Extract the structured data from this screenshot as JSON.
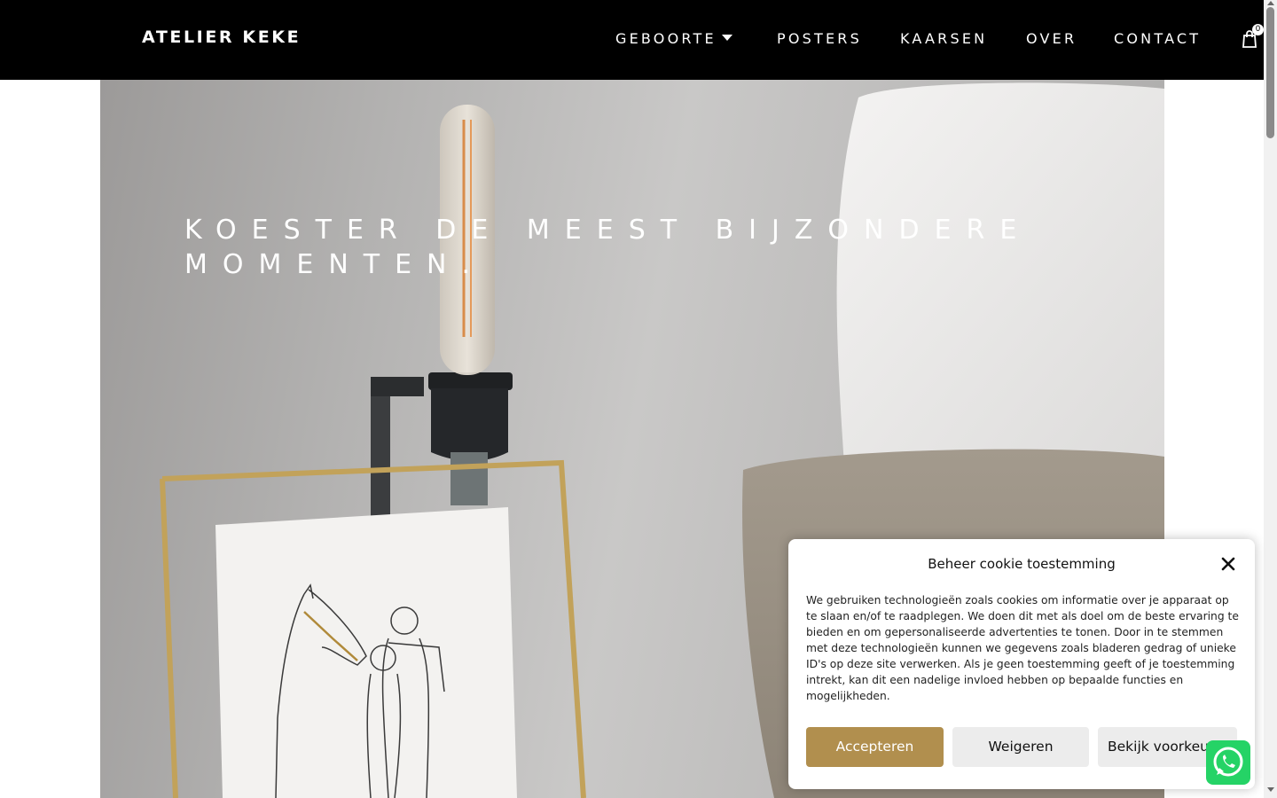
{
  "header": {
    "logo": "ATELIER KEKE",
    "nav": [
      {
        "label": "GEBOORTE",
        "has_dropdown": true
      },
      {
        "label": "POSTERS",
        "has_dropdown": false
      },
      {
        "label": "KAARSEN",
        "has_dropdown": false
      },
      {
        "label": "OVER",
        "has_dropdown": false
      },
      {
        "label": "CONTACT",
        "has_dropdown": false
      }
    ],
    "cart_icon": "shopping-bag-icon",
    "cart_count": "0"
  },
  "hero": {
    "title": "KOESTER DE MEEST BIJZONDERE MOMENTEN."
  },
  "cookie": {
    "title": "Beheer cookie toestemming",
    "text": "We gebruiken technologieën zoals cookies om informatie over je apparaat op te slaan en/of te raadplegen. We doen dit met als doel om de beste ervaring te bieden en om gepersonaliseerde advertenties te tonen. Door in te stemmen met deze technologieën kunnen we gegevens zoals bladeren gedrag of unieke ID's op deze site verwerken. Als je geen toestemming geeft of je toestemming intrekt, kan dit een nadelige invloed hebben op bepaalde functies en mogelijkheden.",
    "accept_label": "Accepteren",
    "deny_label": "Weigeren",
    "prefs_label": "Bekijk voorkeuren",
    "close_icon": "close-icon"
  },
  "whatsapp_icon": "whatsapp-icon",
  "colors": {
    "header_bg": "#000000",
    "accept_button": "#b18f4e",
    "secondary_button": "#ececec",
    "whatsapp": "#25d366"
  }
}
